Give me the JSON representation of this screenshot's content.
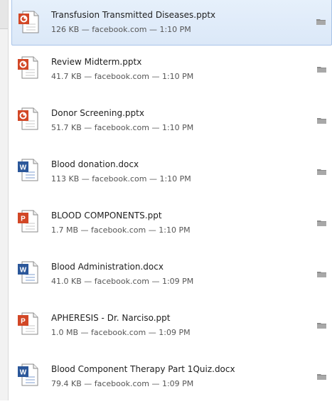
{
  "downloads": [
    {
      "name": "Transfusion Transmitted Diseases.pptx",
      "meta": "126 KB — facebook.com — 1:10 PM",
      "type_icon": "powerpoint-file-icon",
      "selected": true
    },
    {
      "name": "Review Midterm.pptx",
      "meta": "41.7 KB — facebook.com — 1:10 PM",
      "type_icon": "powerpoint-file-icon"
    },
    {
      "name": "Donor Screening.pptx",
      "meta": "51.7 KB — facebook.com — 1:10 PM",
      "type_icon": "powerpoint-file-icon"
    },
    {
      "name": "Blood donation.docx",
      "meta": "113 KB — facebook.com — 1:10 PM",
      "type_icon": "word-file-icon"
    },
    {
      "name": "BLOOD COMPONENTS.ppt",
      "meta": "1.7 MB — facebook.com — 1:10 PM",
      "type_icon": "powerpoint-file-icon"
    },
    {
      "name": "Blood Administration.docx",
      "meta": "41.0 KB — facebook.com — 1:09 PM",
      "type_icon": "word-file-icon"
    },
    {
      "name": "APHERESIS - Dr. Narciso.ppt",
      "meta": "1.0 MB — facebook.com — 1:09 PM",
      "type_icon": "powerpoint-file-icon"
    },
    {
      "name": "Blood Component Therapy Part 1Quiz.docx",
      "meta": "79.4 KB — facebook.com — 1:09 PM",
      "type_icon": "word-file-icon"
    }
  ],
  "colors": {
    "selection_bg": "#dbe8f8",
    "selection_border": "#a9c4e8",
    "powerpoint_accent": "#d24726",
    "word_accent": "#2b579a",
    "meta_text": "#555555"
  }
}
